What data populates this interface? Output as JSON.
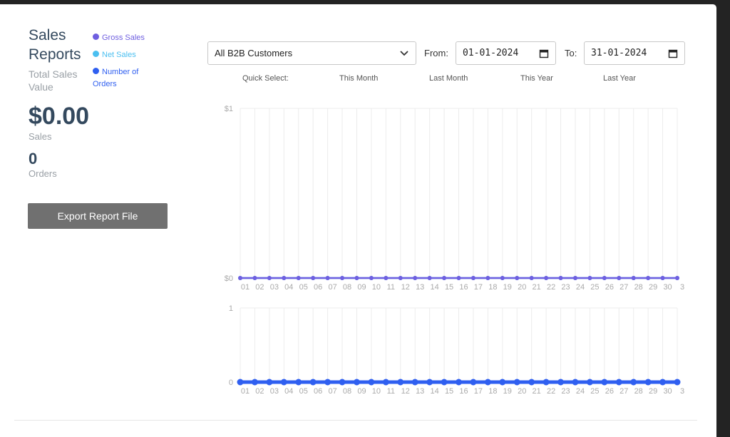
{
  "header": {
    "title": "Sales Reports",
    "subtitle": "Total Sales Value"
  },
  "legend": [
    {
      "label": "Gross Sales",
      "color": "#6f5fe0"
    },
    {
      "label": "Net Sales",
      "color": "#4bbff0"
    },
    {
      "label": "Number of Orders",
      "color": "#2f5ff0"
    }
  ],
  "summary": {
    "total_value": "$0.00",
    "sales_label": "Sales",
    "orders_value": "0",
    "orders_label": "Orders"
  },
  "export_button": "Export Report File",
  "filters": {
    "customer_select": "All B2B Customers",
    "from_label": "From:",
    "from_value": "01-01-2024",
    "to_label": "To:",
    "to_value": "31-01-2024"
  },
  "quick_select": {
    "label": "Quick Select:",
    "options": [
      "This Month",
      "Last Month",
      "This Year",
      "Last Year"
    ]
  },
  "icons": {
    "select_arrow": "chevron-down-icon",
    "date_picker": "calendar-icon"
  },
  "chart_data": [
    {
      "type": "line",
      "x": [
        "01",
        "02",
        "03",
        "04",
        "05",
        "06",
        "07",
        "08",
        "09",
        "10",
        "11",
        "12",
        "13",
        "14",
        "15",
        "16",
        "17",
        "18",
        "19",
        "20",
        "21",
        "22",
        "23",
        "24",
        "25",
        "26",
        "27",
        "28",
        "29",
        "30",
        "3"
      ],
      "series": [
        {
          "name": "Gross Sales",
          "values": [
            0,
            0,
            0,
            0,
            0,
            0,
            0,
            0,
            0,
            0,
            0,
            0,
            0,
            0,
            0,
            0,
            0,
            0,
            0,
            0,
            0,
            0,
            0,
            0,
            0,
            0,
            0,
            0,
            0,
            0,
            0
          ],
          "color": "#6f5fe0"
        },
        {
          "name": "Net Sales",
          "values": [
            0,
            0,
            0,
            0,
            0,
            0,
            0,
            0,
            0,
            0,
            0,
            0,
            0,
            0,
            0,
            0,
            0,
            0,
            0,
            0,
            0,
            0,
            0,
            0,
            0,
            0,
            0,
            0,
            0,
            0,
            0
          ],
          "color": "#4bbff0"
        }
      ],
      "y_ticks": [
        "$0",
        "$1"
      ],
      "ylim": [
        0,
        1
      ],
      "grid": "vertical"
    },
    {
      "type": "line",
      "x": [
        "01",
        "02",
        "03",
        "04",
        "05",
        "06",
        "07",
        "08",
        "09",
        "10",
        "11",
        "12",
        "13",
        "14",
        "15",
        "16",
        "17",
        "18",
        "19",
        "20",
        "21",
        "22",
        "23",
        "24",
        "25",
        "26",
        "27",
        "28",
        "29",
        "30",
        "3"
      ],
      "series": [
        {
          "name": "Number of Orders",
          "values": [
            0,
            0,
            0,
            0,
            0,
            0,
            0,
            0,
            0,
            0,
            0,
            0,
            0,
            0,
            0,
            0,
            0,
            0,
            0,
            0,
            0,
            0,
            0,
            0,
            0,
            0,
            0,
            0,
            0,
            0,
            0
          ],
          "color": "#2f5ff0"
        }
      ],
      "y_ticks": [
        "0",
        "1"
      ],
      "ylim": [
        0,
        1
      ],
      "grid": "vertical"
    }
  ]
}
